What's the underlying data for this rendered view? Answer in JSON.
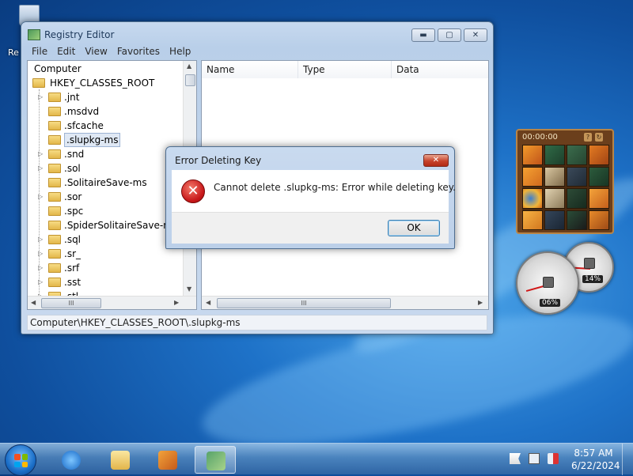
{
  "desktop": {
    "recycle_label": "Re"
  },
  "window": {
    "title": "Registry Editor",
    "caption_buttons": {
      "minimize": "▬",
      "maximize": "▢",
      "close": "✕"
    },
    "menu": [
      "File",
      "Edit",
      "View",
      "Favorites",
      "Help"
    ],
    "tree": {
      "root": "Computer",
      "hive": "HKEY_CLASSES_ROOT",
      "items": [
        ".jnt",
        ".msdvd",
        ".sfcache",
        ".slupkg-ms",
        ".snd",
        ".sol",
        ".SolitaireSave-ms",
        ".sor",
        ".spc",
        ".SpiderSolitaireSave-ms",
        ".sql",
        ".sr_",
        ".srf",
        ".sst",
        ".stl"
      ],
      "selected": ".slupkg-ms"
    },
    "columns": [
      "Name",
      "Type",
      "Data"
    ],
    "status": "Computer\\HKEY_CLASSES_ROOT\\.slupkg-ms",
    "scroll_grip": "III"
  },
  "dialog": {
    "title": "Error Deleting Key",
    "close_glyph": "✕",
    "icon": "error-icon",
    "icon_glyph": "✕",
    "message": "Cannot delete .slupkg-ms:  Error while deleting key.",
    "ok_label": "OK"
  },
  "gadgets": {
    "puzzle_timer": "00:00:00",
    "cpu_value": "06%",
    "cpu_fraction": 0.06,
    "mem_value": "14%",
    "mem_fraction": 0.14
  },
  "taskbar": {
    "clock_time": "8:57 AM",
    "clock_date": "6/22/2024"
  },
  "colors": {
    "accent": "#1e72c8",
    "selection": "#dfe8f4",
    "error_red": "#c8181a"
  }
}
